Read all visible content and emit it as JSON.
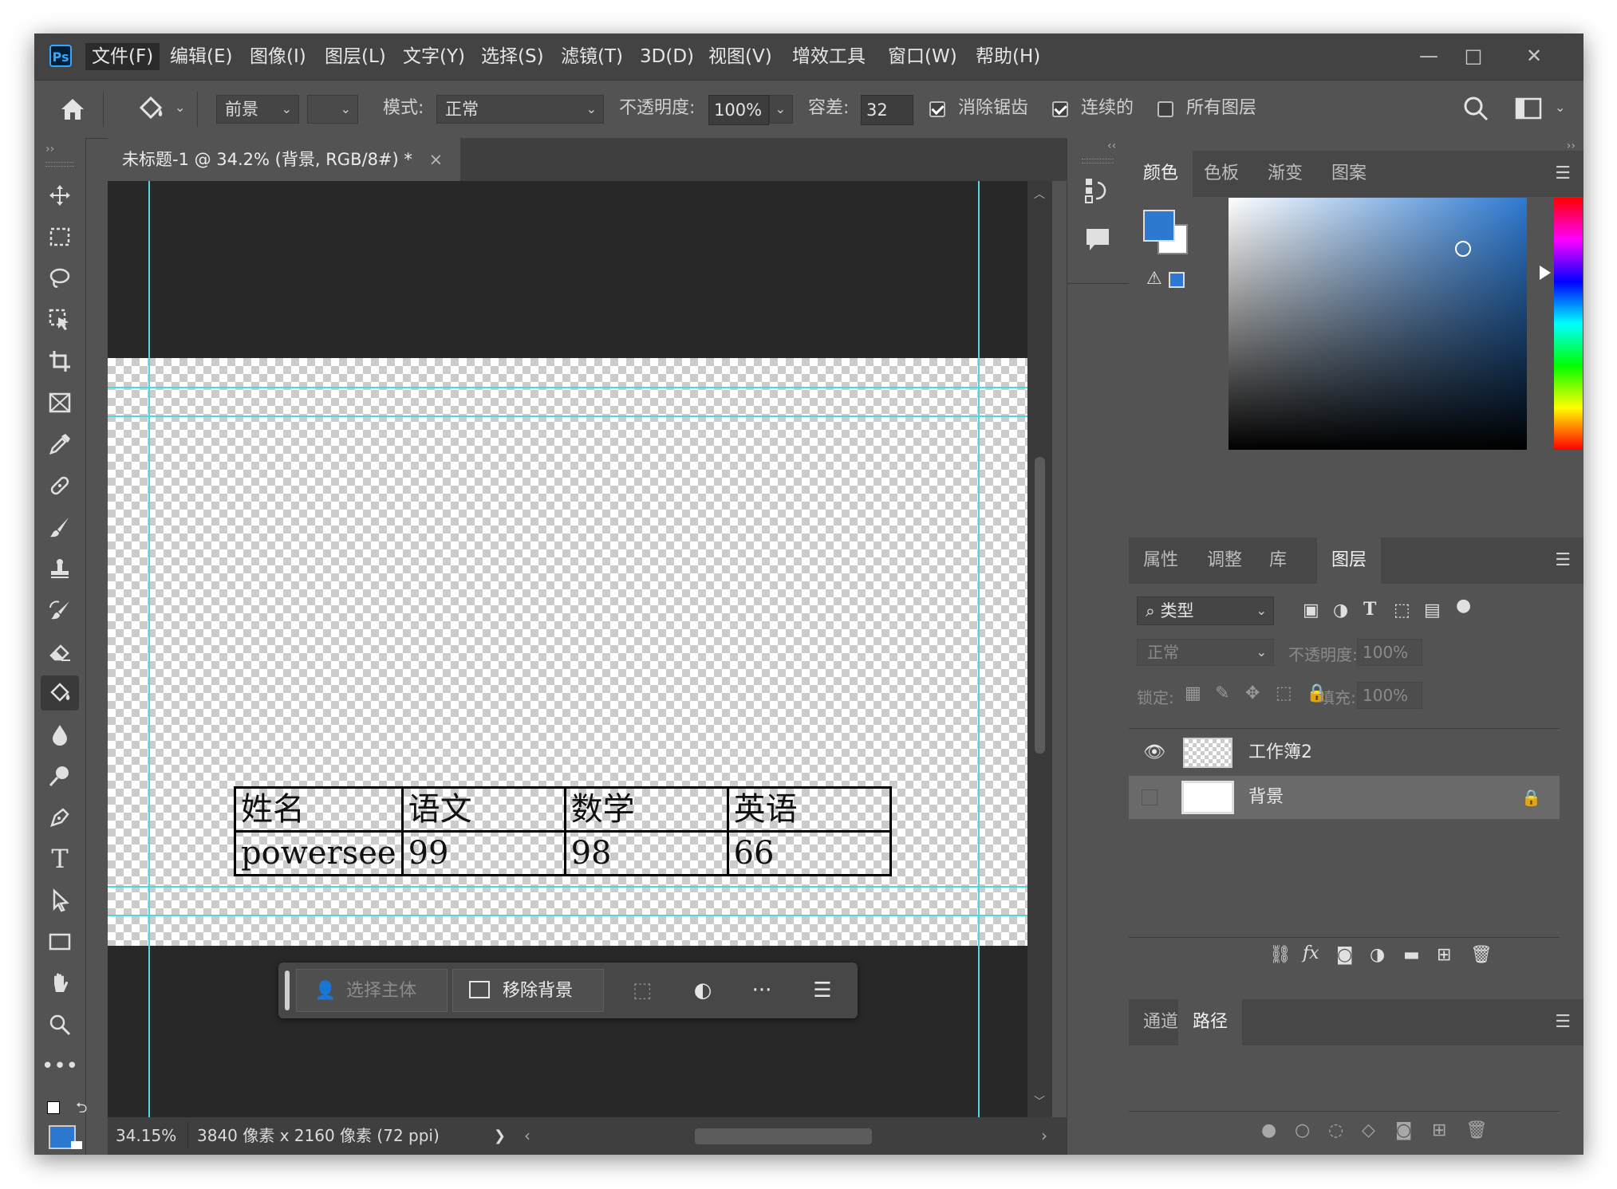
{
  "app": {
    "logo": "Ps",
    "menu": [
      "文件(F)",
      "编辑(E)",
      "图像(I)",
      "图层(L)",
      "文字(Y)",
      "选择(S)",
      "滤镜(T)",
      "3D(D)",
      "视图(V)",
      "增效工具",
      "窗口(W)",
      "帮助(H)"
    ],
    "window_controls": [
      "—",
      "□",
      "✕"
    ]
  },
  "options": {
    "home_icon": "home-icon",
    "tool_icon": "paint-bucket-icon",
    "fill_source": "前景",
    "mode_label": "模式:",
    "mode_value": "正常",
    "opacity_label": "不透明度:",
    "opacity_value": "100%",
    "tolerance_label": "容差:",
    "tolerance_value": "32",
    "antialias_label": "消除锯齿",
    "antialias_checked": true,
    "contiguous_label": "连续的",
    "contiguous_checked": true,
    "all_layers_label": "所有图层",
    "all_layers_checked": false
  },
  "tools": [
    "move-tool-icon",
    "marquee-tool-icon",
    "lasso-tool-icon",
    "object-select-tool-icon",
    "crop-tool-icon",
    "frame-tool-icon",
    "eyedropper-tool-icon",
    "healing-brush-tool-icon",
    "brush-tool-icon",
    "stamp-tool-icon",
    "history-brush-tool-icon",
    "eraser-tool-icon",
    "paint-bucket-tool-icon",
    "blur-tool-icon",
    "dodge-tool-icon",
    "pen-tool-icon",
    "type-tool-icon",
    "path-select-tool-icon",
    "rectangle-tool-icon",
    "hand-tool-icon",
    "zoom-tool-icon",
    "more-tools-icon"
  ],
  "document": {
    "tab_title": "未标题-1 @ 34.2% (背景, RGB/8#) *",
    "close": "×",
    "table": [
      [
        "姓名",
        "语文",
        "数学",
        "英语"
      ],
      [
        "powersee",
        "99",
        "98",
        "66"
      ]
    ]
  },
  "taskbar": {
    "select_subject": "选择主体",
    "remove_background": "移除背景",
    "more": "···"
  },
  "status": {
    "zoom": "34.15%",
    "info": "3840 像素 x 2160 像素 (72 ppi)",
    "arrow": "❯"
  },
  "panels": {
    "color_tabs": [
      "颜色",
      "色板",
      "渐变",
      "图案"
    ],
    "foreground_color": "#2d79d1",
    "background_color": "#ffffff",
    "layer_tabs": [
      "属性",
      "调整",
      "库",
      "图层"
    ],
    "filter_kind": "类型",
    "blend_mode": "正常",
    "opacity_label": "不透明度:",
    "opacity_value": "100%",
    "lock_label": "锁定:",
    "fill_label": "填充:",
    "fill_value": "100%",
    "layers": [
      {
        "name": "工作簿2",
        "visible": true
      },
      {
        "name": "背景",
        "visible": false,
        "locked": true
      }
    ],
    "path_tabs": [
      "通道",
      "路径"
    ]
  }
}
